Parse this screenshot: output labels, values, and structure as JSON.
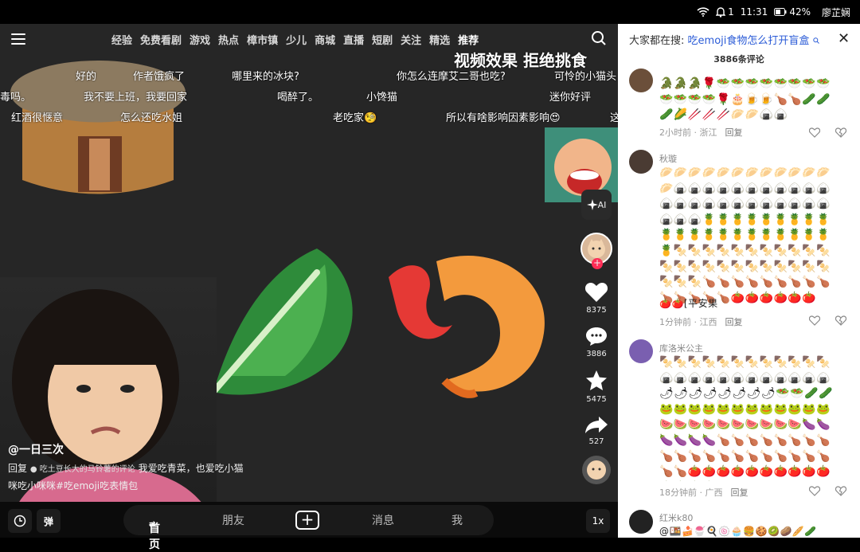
{
  "status": {
    "time": "11:31",
    "notif": "1",
    "battery": "42%",
    "user": "廖芷娴"
  },
  "nav": {
    "tabs": [
      "经验",
      "免费看剧",
      "游戏",
      "热点",
      "樟市镇",
      "少儿",
      "商城",
      "直播",
      "短剧",
      "关注",
      "精选",
      "推荐"
    ],
    "active": "推荐"
  },
  "video": {
    "overlay": "视频效果  拒绝挑食",
    "danmaku": [
      {
        "t": "好的"
      },
      {
        "t": "作者饿疯了"
      },
      {
        "t": "哪里来的冰块?"
      },
      {
        "t": "你怎么连摩艾二哥也吃?"
      },
      {
        "t": "可怜的小猫头"
      },
      {
        "t": "毒吗。"
      },
      {
        "t": "我不要上班，我要回家"
      },
      {
        "t": "喝醉了。"
      },
      {
        "t": "小馋猫"
      },
      {
        "t": "迷你好评"
      },
      {
        "t": "红酒很惬意"
      },
      {
        "t": "怎么还吃水姐"
      },
      {
        "t": "老吃家🧐"
      },
      {
        "t": "所以有啥影响因素影响😍"
      },
      {
        "t": "这"
      }
    ],
    "author": "@一日三次",
    "reply_prefix": "回复",
    "reply_ref": "吃土豆长大的马铃薯的评论",
    "reply_text": "我爱吃青菜，也爱吃小猫咪吃小咪咪#吃emoji吃表情包",
    "ai_label": "AI",
    "likes": "8375",
    "comments": "3886",
    "favorites": "5475",
    "shares": "527"
  },
  "bottom": {
    "home": "首页",
    "friends": "朋友",
    "messages": "消息",
    "me": "我",
    "speed": "1x"
  },
  "panel": {
    "search_prefix": "大家都在搜:",
    "search_query": "吃emoji食物怎么打开盲盒",
    "count": "3886条评论",
    "comments": [
      {
        "name": "",
        "emoji": "🐊🐊🐊🌹🥗🥗🥗🥗🥗🥗🥗🥗🥗🥗🥗🥗🌹🎂🍺🍺🍗🍗🥒🥒🥒🌽🥢🥢🥢🥟🥟🍙🍙",
        "time": "2小时前 · 浙江",
        "reply": "回复"
      },
      {
        "name": "秋璇",
        "emoji": "🥟🥟🥟🥟🥟🥟🥟🥟🥟🥟🥟🥟🥟🍙🍙🍙🍙🍙🍙🍙🍙🍙🍙🍙🍙🍙🍙🍙🍙🍙🍙🍙🍙🍙🍙🍙🍙🍙🍙🍍🍍🍍🍍🍍🍍🍍🍍🍍🍍🍍🍍🍍🍍🍍🍍🍍🍍🍍🍍🍍🍍🍢🍢🍢🍢🍢🍢🍢🍢🍢🍢🍢🍢🍢🍢🍢🍢🍢🍢🍢🍢🍢🍢🍢🍢🍢🍢🍗🍗🍗🍗🍗🍗🍗🍗🍗🍗🍗🍗🍗🍗🍅🍅🍅🍅🍅🍅",
        "tail": "🍅🍅[平安果",
        "time": "1分钟前 · 江西",
        "reply": "回复"
      },
      {
        "name": "库洛米公主",
        "emoji": "🍢🍢🍢🍢🍢🍢🍢🍢🍢🍢🍢🍢🍙🍙🍙🍙🍙🍙🍙🍙🍙🍙🍙🍙🌶🌶🌶🌶🌶🌶🌶🌶🥗🥗🥒🥒🐸🐸🐸🐸🐸🐸🐸🐸🐸🐸🐸🐸🍉🍉🍉🍉🍉🍉🍉🍉🍉🍉🍆🍆🍆🍆🍆🍆🍗🍗🍗🍗🍗🍗🍗🍗🍗🍗🍗🍗🍗🍗🍗🍗🍗🍗🍗🍗🍗🍗🍅🍅🍅🍅🍅🍅🍅🍅🍅🍅🍅🍅🍅🍅🍤🍤🍤🍤",
        "time": "18分钟前 · 广西",
        "reply": "回复"
      },
      {
        "name": "红米k80",
        "emoji": "@🍱🍰🍧🍳🍥🧁🍔🍪🥝🥔🥖🥒",
        "time": "",
        "reply": ""
      }
    ]
  }
}
